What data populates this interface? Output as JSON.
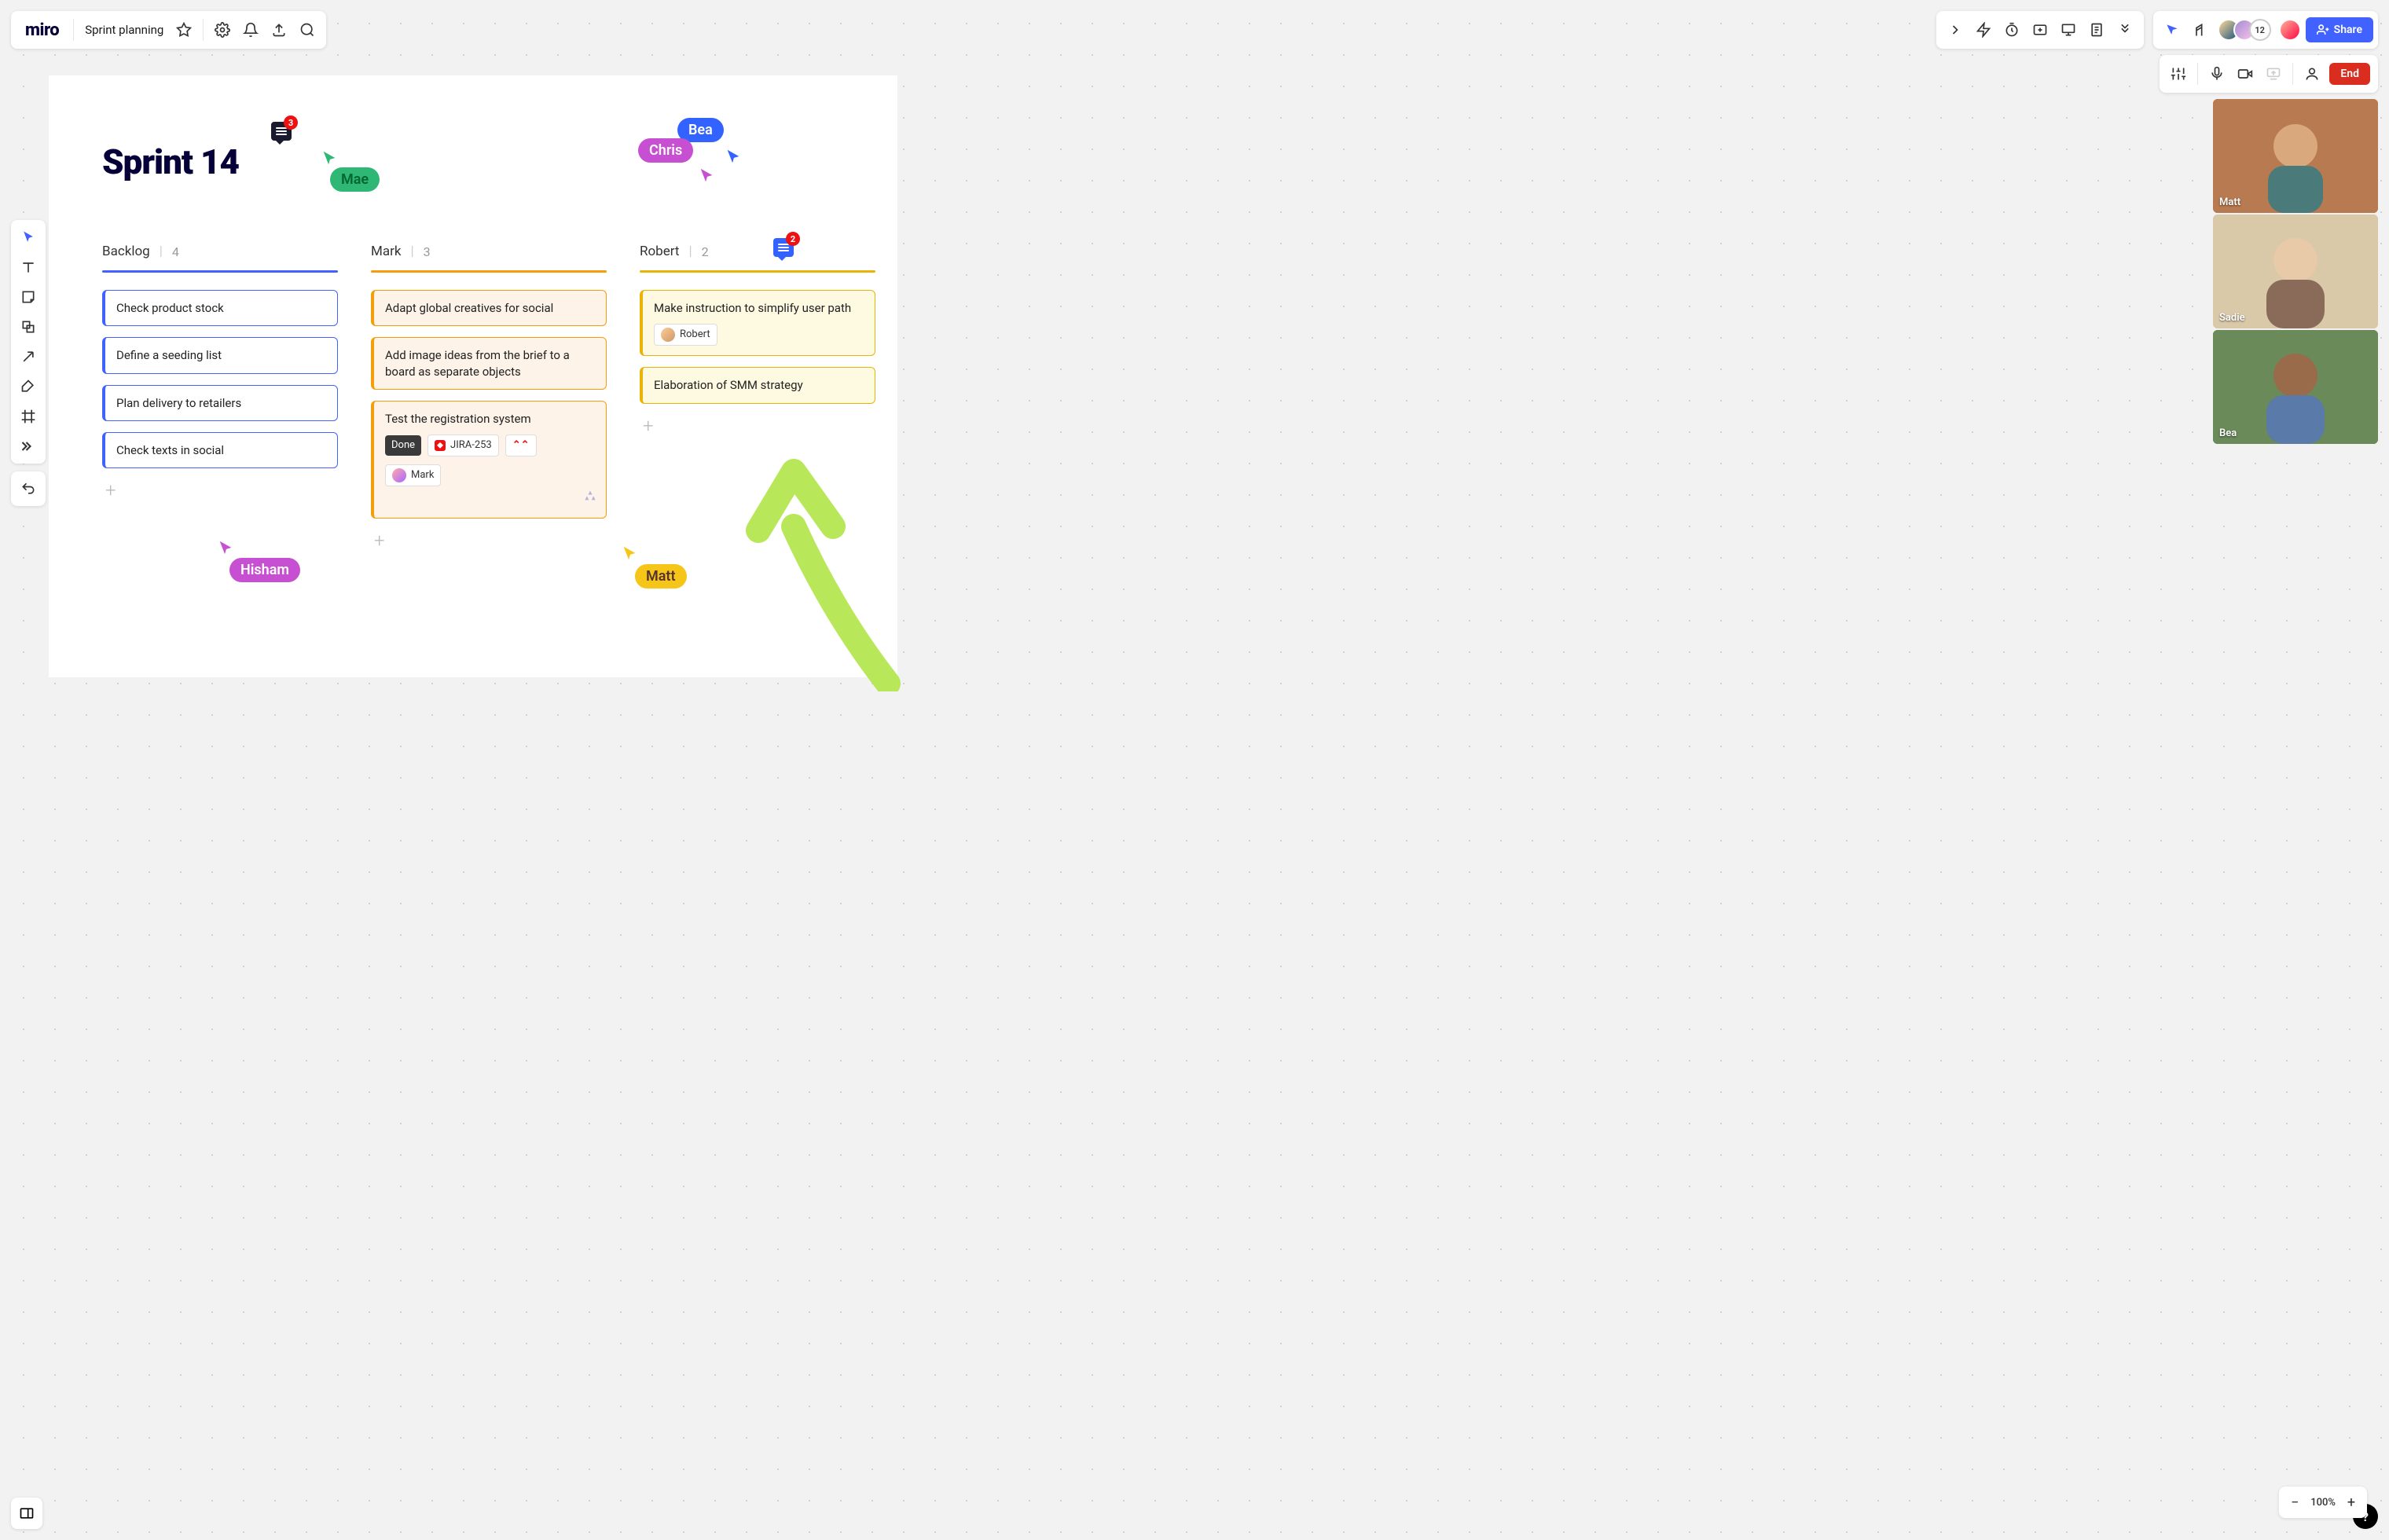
{
  "app": {
    "logo": "miro",
    "board_name": "Sprint planning"
  },
  "header_avatar_count": "12",
  "share_label": "Share",
  "end_label": "End",
  "board_title": "Sprint 14",
  "comments": {
    "title_badge": "3",
    "robert_badge": "2"
  },
  "cursors": {
    "mae": "Mae",
    "bea": "Bea",
    "chris": "Chris",
    "hisham": "Hisham",
    "matt": "Matt"
  },
  "columns": [
    {
      "name": "Backlog",
      "count": "4",
      "color": "#4262ff",
      "cards": [
        {
          "text": "Check product stock"
        },
        {
          "text": "Define a seeding list"
        },
        {
          "text": "Plan delivery to retailers"
        },
        {
          "text": "Check texts in social"
        }
      ]
    },
    {
      "name": "Mark",
      "count": "3",
      "color": "#f59e0b",
      "cards": [
        {
          "text": "Adapt global creatives for social"
        },
        {
          "text": "Add image ideas from the brief to a board as separate objects"
        },
        {
          "text": "Test the registration system",
          "status": "Done",
          "jira": "JIRA-253",
          "assignee": "Mark"
        }
      ]
    },
    {
      "name": "Robert",
      "count": "2",
      "color": "#eab308",
      "cards": [
        {
          "text": "Make instruction to simplify user path",
          "assignee": "Robert"
        },
        {
          "text": "Elaboration of SMM strategy"
        }
      ]
    }
  ],
  "videos": [
    {
      "name": "Matt"
    },
    {
      "name": "Sadie"
    },
    {
      "name": "Bea"
    }
  ],
  "zoom": "100%"
}
